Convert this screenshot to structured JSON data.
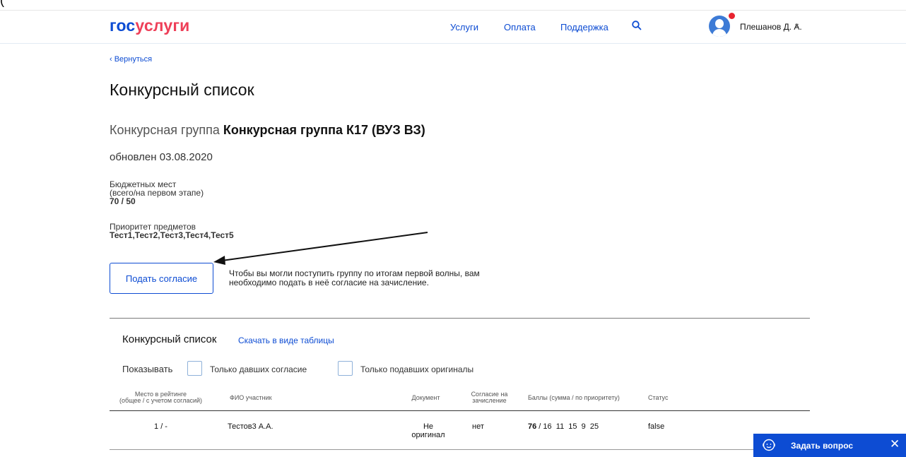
{
  "header": {
    "logo_part1": "гос",
    "logo_part2": "услуги",
    "nav_services": "Услуги",
    "nav_payment": "Оплата",
    "nav_support": "Поддержка",
    "username": "Плешанов Д. А.",
    "user_caret": "▾",
    "icons": [
      "search-icon",
      "avatar",
      "notification-dot",
      "chevron-down-icon"
    ]
  },
  "page": {
    "back_link": "‹ Вернуться",
    "title": "Конкурсный список",
    "group_prefix": "Конкурсная группа",
    "group_name": "Конкурсная группа К17 (ВУЗ ВЗ)",
    "updated": "обновлен 03.08.2020",
    "budget_label": "Бюджетных мест",
    "budget_sub": "(всего/на первом этапе)",
    "budget_value": "70 / 50",
    "priority_label": "Приоритет предметов",
    "priority_value": "Тест1,Тест2,Тест3,Тест4,Тест5",
    "consent_button": "Подать согласие",
    "hint_line1": "Чтобы вы могли поступить группу по итогам первой волны, вам",
    "hint_line2": "необходимо подать в неё согласие на зачисление."
  },
  "list": {
    "title": "Конкурсный список",
    "download": "Скачать в виде таблицы",
    "show_label": "Показывать",
    "filter_consent": "Только давших согласие",
    "filter_originals": "Только подавших оригиналы",
    "columns": {
      "rank_line1": "Место в рейтинге",
      "rank_line2": "(общее / с учетом согласий)",
      "fio": "ФИО участник",
      "document": "Документ",
      "consent_line1": "Согласие на",
      "consent_line2": "зачисление",
      "score": "Баллы (сумма / по приоритету)",
      "status": "Статус"
    },
    "rows": [
      {
        "rank": "1 / -",
        "fio": "Тестов3 А.А.",
        "document_line1": "Не",
        "document_line2": "оригинал",
        "consent": "нет",
        "score_total": "76",
        "score_parts": " / 16  11  15  9  25",
        "status": "false"
      }
    ]
  },
  "chat": {
    "label": "Задать вопрос",
    "close": "✕",
    "icon": "chat-bot-icon"
  },
  "colors": {
    "brand_blue": "#0d4cd3",
    "brand_red": "#ee3f58",
    "notification": "#e8232f"
  }
}
